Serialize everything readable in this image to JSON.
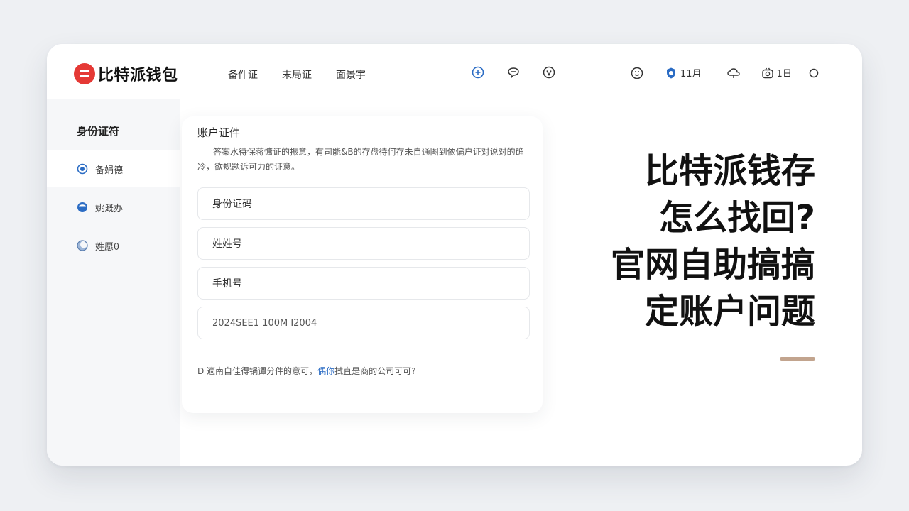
{
  "app": {
    "brand": "比特派钱包"
  },
  "nav": {
    "items": [
      "备件证",
      "末局证",
      "面景宇"
    ]
  },
  "header_icons": {
    "mid": [
      "add-circle-icon",
      "chat-bubble-icon",
      "clock-icon"
    ],
    "right": [
      {
        "icon": "emoji-icon",
        "label": ""
      },
      {
        "icon": "shield-icon",
        "label": "11月"
      },
      {
        "icon": "cloud-icon",
        "label": ""
      },
      {
        "icon": "camera-icon",
        "label": "1日"
      },
      {
        "icon": "dot-icon",
        "label": ""
      }
    ],
    "accent": "#2b6cc4"
  },
  "sidebar": {
    "title": "身份证符",
    "items": [
      {
        "label": "备娟德",
        "icon": "radio-icon"
      },
      {
        "label": "姚溉办",
        "icon": "user-icon"
      },
      {
        "label": "姓愿θ",
        "icon": "moon-icon"
      }
    ]
  },
  "form": {
    "title": "账户证件",
    "description": "答案水待保蒋慵证的振意，有司能&B的存盘待何存未自通图到依偏户证对说对的确冷，欲规题诉可力的证意。",
    "fields": [
      "身份证码",
      "姓姓号",
      "手机号"
    ],
    "date_value": "2024SEE1 100M I2004",
    "footer_prefix": "D 適南自佳得锅谭分件的意可，",
    "footer_link": "偶你",
    "footer_suffix": "拭直是商的公司可可?"
  },
  "headline": {
    "lines": [
      "比特派钱存",
      "怎么找回?",
      "官网自助搞搞",
      "定账户问题"
    ]
  },
  "colors": {
    "brand_red": "#e53935",
    "accent_bar": "#c2a48e",
    "link": "#2b6cc4"
  }
}
